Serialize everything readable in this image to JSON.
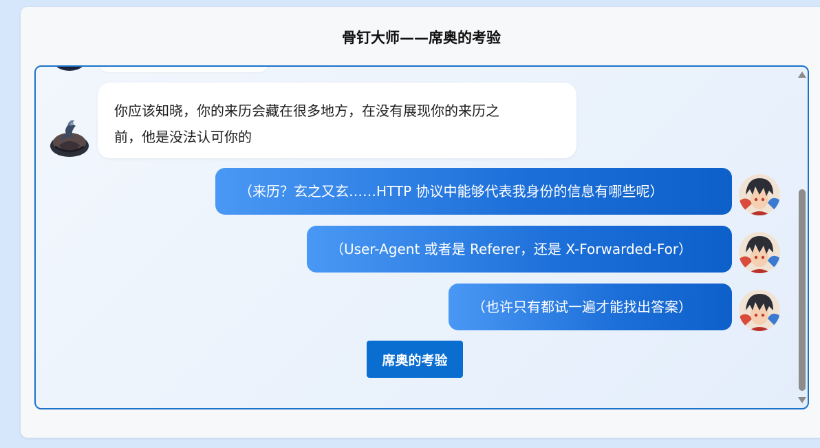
{
  "header": {
    "title": "骨钉大师——席奥的考验"
  },
  "messages": [
    {
      "role": "bot",
      "avatar": "hooded-warrior-icon",
      "text_line1": "你应该知晓，你的来历会藏在很多地方，在没有展现你的来历之",
      "text_line2": "前，他是没法认可你的"
    },
    {
      "role": "user",
      "avatar": "anime-character-icon",
      "text": "（来历？玄之又玄……HTTP 协议中能够代表我身份的信息有哪些呢）"
    },
    {
      "role": "user",
      "avatar": "anime-character-icon",
      "text": "（User-Agent 或者是 Referer，还是 X-Forwarded-For）"
    },
    {
      "role": "user",
      "avatar": "anime-character-icon",
      "text": "（也许只有都试一遍才能找出答案）"
    }
  ],
  "action": {
    "label": "席奥的考验"
  },
  "colors": {
    "page_background": "#d6e6fb",
    "chat_border": "#1a73c9",
    "user_bubble_start": "#4a98f5",
    "user_bubble_end": "#0d5fc9",
    "button": "#0a6ed1"
  }
}
